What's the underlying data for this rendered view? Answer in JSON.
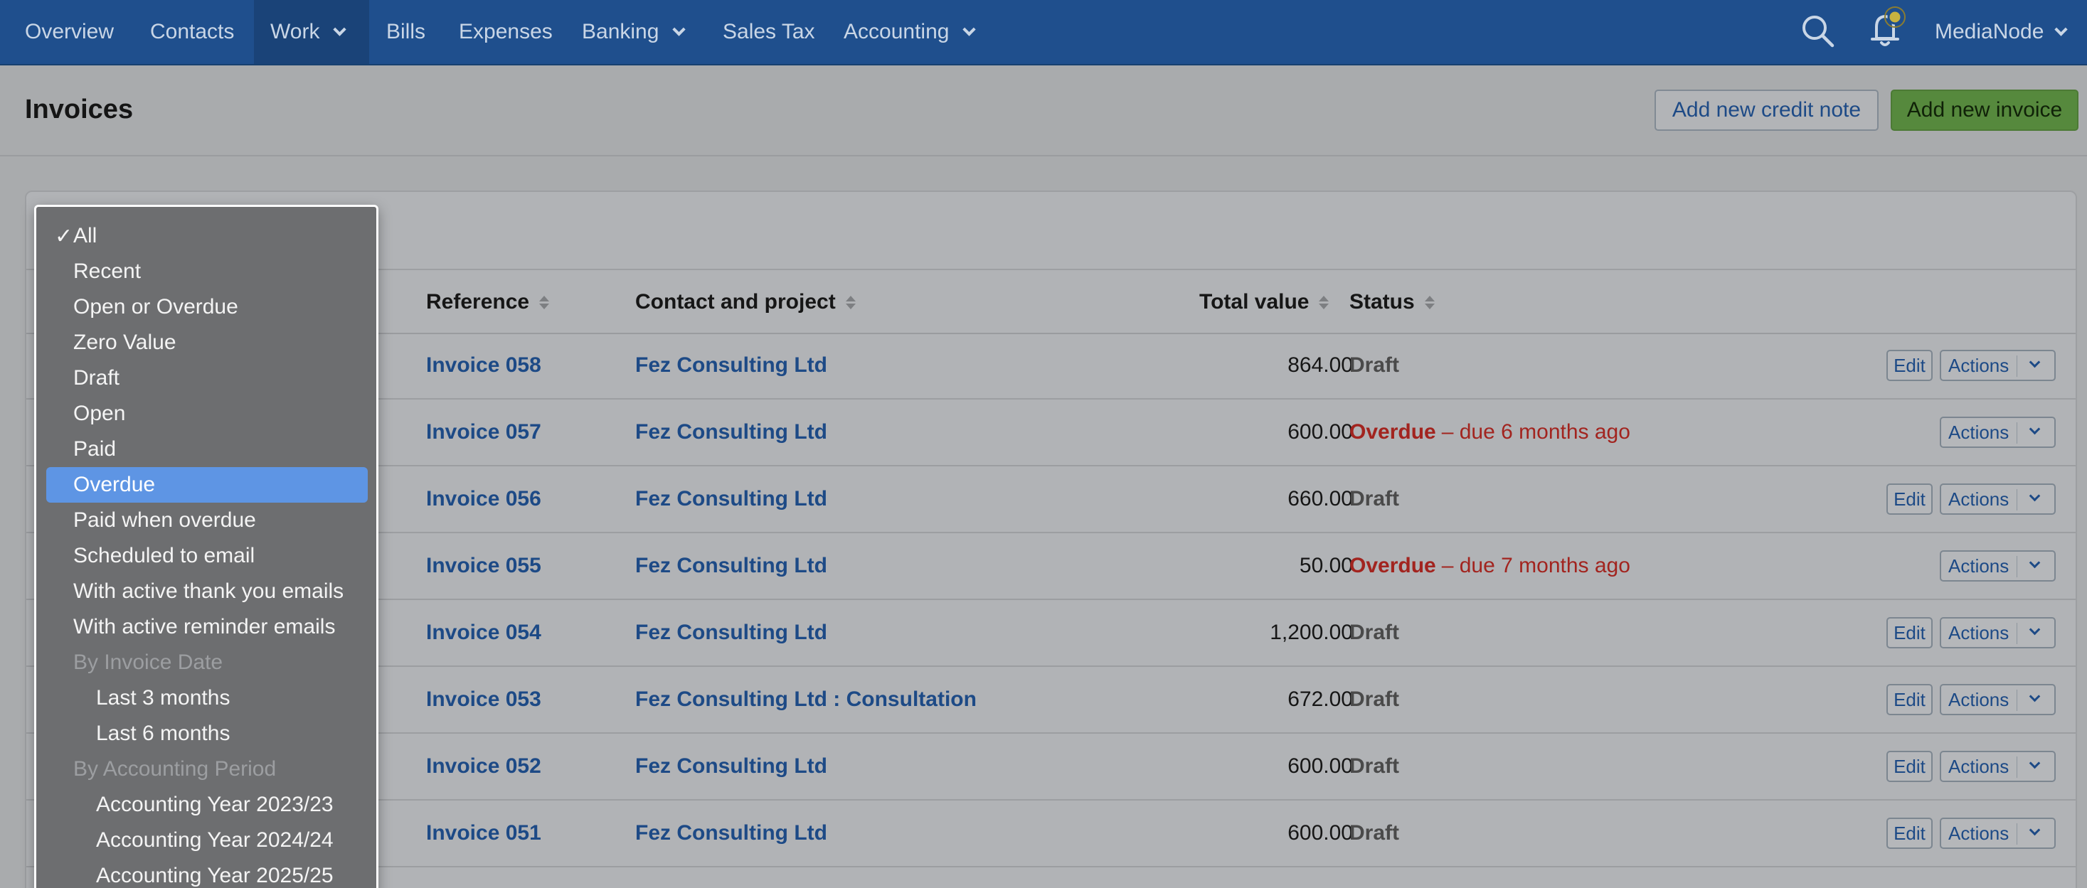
{
  "nav": {
    "items": [
      {
        "label": "Overview",
        "dropdown": false
      },
      {
        "label": "Contacts",
        "dropdown": false
      },
      {
        "label": "Work",
        "dropdown": true,
        "active": true
      },
      {
        "label": "Bills",
        "dropdown": false
      },
      {
        "label": "Expenses",
        "dropdown": false
      },
      {
        "label": "Banking",
        "dropdown": true
      },
      {
        "label": "Sales Tax",
        "dropdown": false
      },
      {
        "label": "Accounting",
        "dropdown": true
      }
    ],
    "account_label": "MediaNode",
    "icons": [
      "search-icon",
      "bell-icon"
    ]
  },
  "page": {
    "title": "Invoices",
    "credit_note_button": "Add new credit note",
    "new_invoice_button": "Add new invoice"
  },
  "table": {
    "headers": {
      "reference": "Reference",
      "contact": "Contact and project",
      "total": "Total value",
      "status": "Status"
    },
    "rows": [
      {
        "reference": "Invoice 058",
        "contact": "Fez Consulting Ltd",
        "total": "864.00",
        "status": "Draft",
        "note": "",
        "edit": true
      },
      {
        "reference": "Invoice 057",
        "contact": "Fez Consulting Ltd",
        "total": "600.00",
        "status": "Overdue",
        "note": "– due 6 months ago",
        "edit": false
      },
      {
        "reference": "Invoice 056",
        "contact": "Fez Consulting Ltd",
        "total": "660.00",
        "status": "Draft",
        "note": "",
        "edit": true
      },
      {
        "reference": "Invoice 055",
        "contact": "Fez Consulting Ltd",
        "total": "50.00",
        "status": "Overdue",
        "note": "– due 7 months ago",
        "edit": false
      },
      {
        "reference": "Invoice 054",
        "contact": "Fez Consulting Ltd",
        "total": "1,200.00",
        "status": "Draft",
        "note": "",
        "edit": true
      },
      {
        "reference": "Invoice 053",
        "contact": "Fez Consulting Ltd : Consultation",
        "total": "672.00",
        "status": "Draft",
        "note": "",
        "edit": true
      },
      {
        "reference": "Invoice 052",
        "contact": "Fez Consulting Ltd",
        "total": "600.00",
        "status": "Draft",
        "note": "",
        "edit": true
      },
      {
        "reference": "Invoice 051",
        "contact": "Fez Consulting Ltd",
        "total": "600.00",
        "status": "Draft",
        "note": "",
        "edit": true
      }
    ],
    "edit_label": "Edit",
    "actions_label": "Actions"
  },
  "filter_dropdown": {
    "check_mark": "✓",
    "options": [
      {
        "label": "All",
        "checked": true,
        "kind": "option"
      },
      {
        "label": "Recent",
        "kind": "option"
      },
      {
        "label": "Open or Overdue",
        "kind": "option"
      },
      {
        "label": "Zero Value",
        "kind": "option"
      },
      {
        "label": "Draft",
        "kind": "option"
      },
      {
        "label": "Open",
        "kind": "option"
      },
      {
        "label": "Paid",
        "kind": "option"
      },
      {
        "label": "Overdue",
        "kind": "option",
        "highlighted": true
      },
      {
        "label": "Paid when overdue",
        "kind": "option"
      },
      {
        "label": "Scheduled to email",
        "kind": "option"
      },
      {
        "label": "With active thank you emails",
        "kind": "option"
      },
      {
        "label": "With active reminder emails",
        "kind": "option"
      },
      {
        "label": "By Invoice Date",
        "kind": "group"
      },
      {
        "label": "Last 3 months",
        "kind": "sub"
      },
      {
        "label": "Last 6 months",
        "kind": "sub"
      },
      {
        "label": "By Accounting Period",
        "kind": "group"
      },
      {
        "label": "Accounting Year 2023/23",
        "kind": "sub"
      },
      {
        "label": "Accounting Year 2024/24",
        "kind": "sub"
      },
      {
        "label": "Accounting Year 2025/25",
        "kind": "sub"
      }
    ]
  },
  "colors": {
    "nav_bg": "#1f4f8d",
    "link": "#1d4a86",
    "overdue": "#a2241f",
    "primary_button": "#56893d",
    "highlight": "#5e95e4"
  }
}
